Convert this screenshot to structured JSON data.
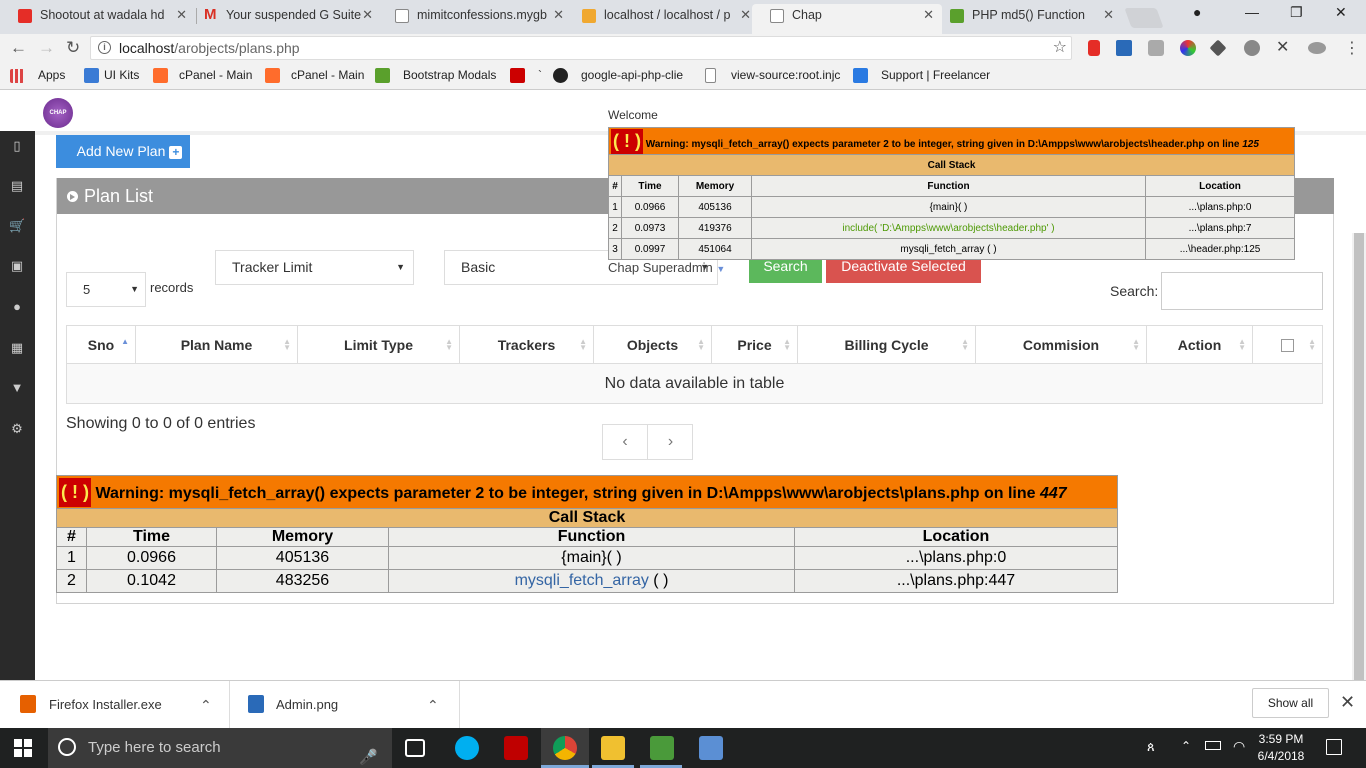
{
  "browser": {
    "tabs": [
      {
        "title": "Shootout at wadala hd",
        "favicon_color": "#e52d27",
        "icon": "youtube-icon"
      },
      {
        "title": "Your suspended G Suite",
        "favicon_color": "#d93025",
        "icon": "gmail-icon"
      },
      {
        "title": "mimitconfessions.mygb",
        "favicon_color": "#888888",
        "icon": "page-icon"
      },
      {
        "title": "localhost / localhost / p",
        "favicon_color": "#f0a830",
        "icon": "phpmyadmin-icon"
      },
      {
        "title": "Chap",
        "favicon_color": "#888888",
        "icon": "page-icon"
      },
      {
        "title": "PHP md5() Function",
        "favicon_color": "#5aa02c",
        "icon": "w3schools-icon"
      }
    ],
    "active_tab": 4,
    "url_host": "localhost",
    "url_path": "/arobjects/plans.php",
    "bookmarks": [
      {
        "label": "Apps",
        "color": "#d44"
      },
      {
        "label": "UI Kits",
        "color": "#3a7bd5"
      },
      {
        "label": "cPanel - Main",
        "color": "#ff6c2c"
      },
      {
        "label": "cPanel - Main",
        "color": "#ff6c2c"
      },
      {
        "label": "Bootstrap Modals",
        "color": "#5aa02c"
      },
      {
        "label": "",
        "color": "#cc0000"
      },
      {
        "label": "`",
        "color": "#ffffff"
      },
      {
        "label": "google-api-php-clie",
        "color": "#222222"
      },
      {
        "label": "view-source:root.injc",
        "color": "#888888"
      },
      {
        "label": "Support | Freelancer",
        "color": "#2a7ae2"
      }
    ]
  },
  "page": {
    "logo_text": "CHAP",
    "welcome": "Welcome",
    "user_name": "Chap Superadmin",
    "add_plan_label": "Add New Plan",
    "panel_title": "Plan List",
    "filters": {
      "limit_type": "Tracker Limit",
      "plan": "Basic",
      "search_button": "Search",
      "deactivate_button": "Deactivate Selected"
    },
    "records_value": "5",
    "records_label": "records",
    "search_label": "Search:",
    "table": {
      "columns": [
        "Sno",
        "Plan Name",
        "Limit Type",
        "Trackers",
        "Objects",
        "Price",
        "Billing Cycle",
        "Commision",
        "Action"
      ],
      "empty_message": "No data available in table"
    },
    "info_text": "Showing 0 to 0 of 0 entries",
    "pager": {
      "prev": "‹",
      "next": "›"
    }
  },
  "error_header": {
    "mark": "( ! )",
    "message": "Warning: mysqli_fetch_array() expects parameter 2 to be integer, string given in D:\\Ampps\\www\\arobjects\\header.php on line ",
    "line": "125",
    "call_stack_label": "Call Stack",
    "columns": [
      "#",
      "Time",
      "Memory",
      "Function",
      "Location"
    ],
    "rows": [
      [
        "1",
        "0.0966",
        "405136",
        "{main}( )",
        "...\\plans.php:0"
      ],
      [
        "2",
        "0.0973",
        "419376",
        "include( 'D:\\Ampps\\www\\arobjects\\header.php' )",
        "...\\plans.php:7"
      ],
      [
        "3",
        "0.0997",
        "451064",
        "mysqli_fetch_array ( )",
        "...\\header.php:125"
      ]
    ]
  },
  "error_plans": {
    "mark": "( ! )",
    "message": "Warning: mysqli_fetch_array() expects parameter 2 to be integer, string given in D:\\Ampps\\www\\arobjects\\plans.php on line ",
    "line": "447",
    "call_stack_label": "Call Stack",
    "columns": [
      "#",
      "Time",
      "Memory",
      "Function",
      "Location"
    ],
    "rows": [
      [
        "1",
        "0.0966",
        "405136",
        "{main}( )",
        "...\\plans.php:0"
      ],
      [
        "2",
        "0.1042",
        "483256",
        "mysqli_fetch_array",
        "...\\plans.php:447"
      ]
    ],
    "row2_fn_suffix": " ( )"
  },
  "downloads": {
    "items": [
      {
        "name": "Firefox Installer.exe",
        "color": "#e66000"
      },
      {
        "name": "Admin.png",
        "color": "#2a6ab8"
      }
    ],
    "show_all": "Show all"
  },
  "taskbar": {
    "search_placeholder": "Type here to search",
    "time": "3:59 PM",
    "date": "6/4/2018"
  }
}
